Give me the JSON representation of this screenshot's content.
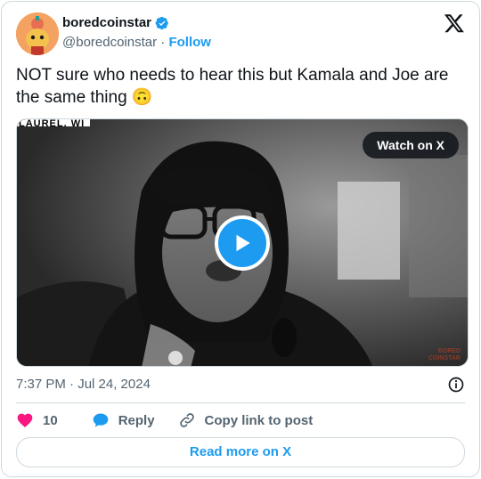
{
  "author": {
    "display_name": "boredcoinstar",
    "handle": "@boredcoinstar",
    "separator": "·",
    "follow_label": "Follow",
    "verified": true
  },
  "tweet": {
    "text": "NOT sure who needs to hear this but Kamala and Joe are the same thing 🙃"
  },
  "media": {
    "location_tag": "LAUREL, WI",
    "watch_label": "Watch on X",
    "watermark_line1": "BORED",
    "watermark_line2": "COINSTAR"
  },
  "meta": {
    "timestamp": "7:37 PM · Jul 24, 2024"
  },
  "actions": {
    "like_count": "10",
    "reply_label": "Reply",
    "copy_link_label": "Copy link to post"
  },
  "footer": {
    "read_more_label": "Read more on X"
  },
  "colors": {
    "accent": "#1d9bf0",
    "like": "#f91880",
    "text": "#0f1419",
    "secondary": "#536471",
    "border": "#cfd9de"
  },
  "icons": [
    "verified-badge-icon",
    "x-logo-icon",
    "play-icon",
    "info-icon",
    "heart-icon",
    "reply-bubble-icon",
    "link-icon"
  ]
}
